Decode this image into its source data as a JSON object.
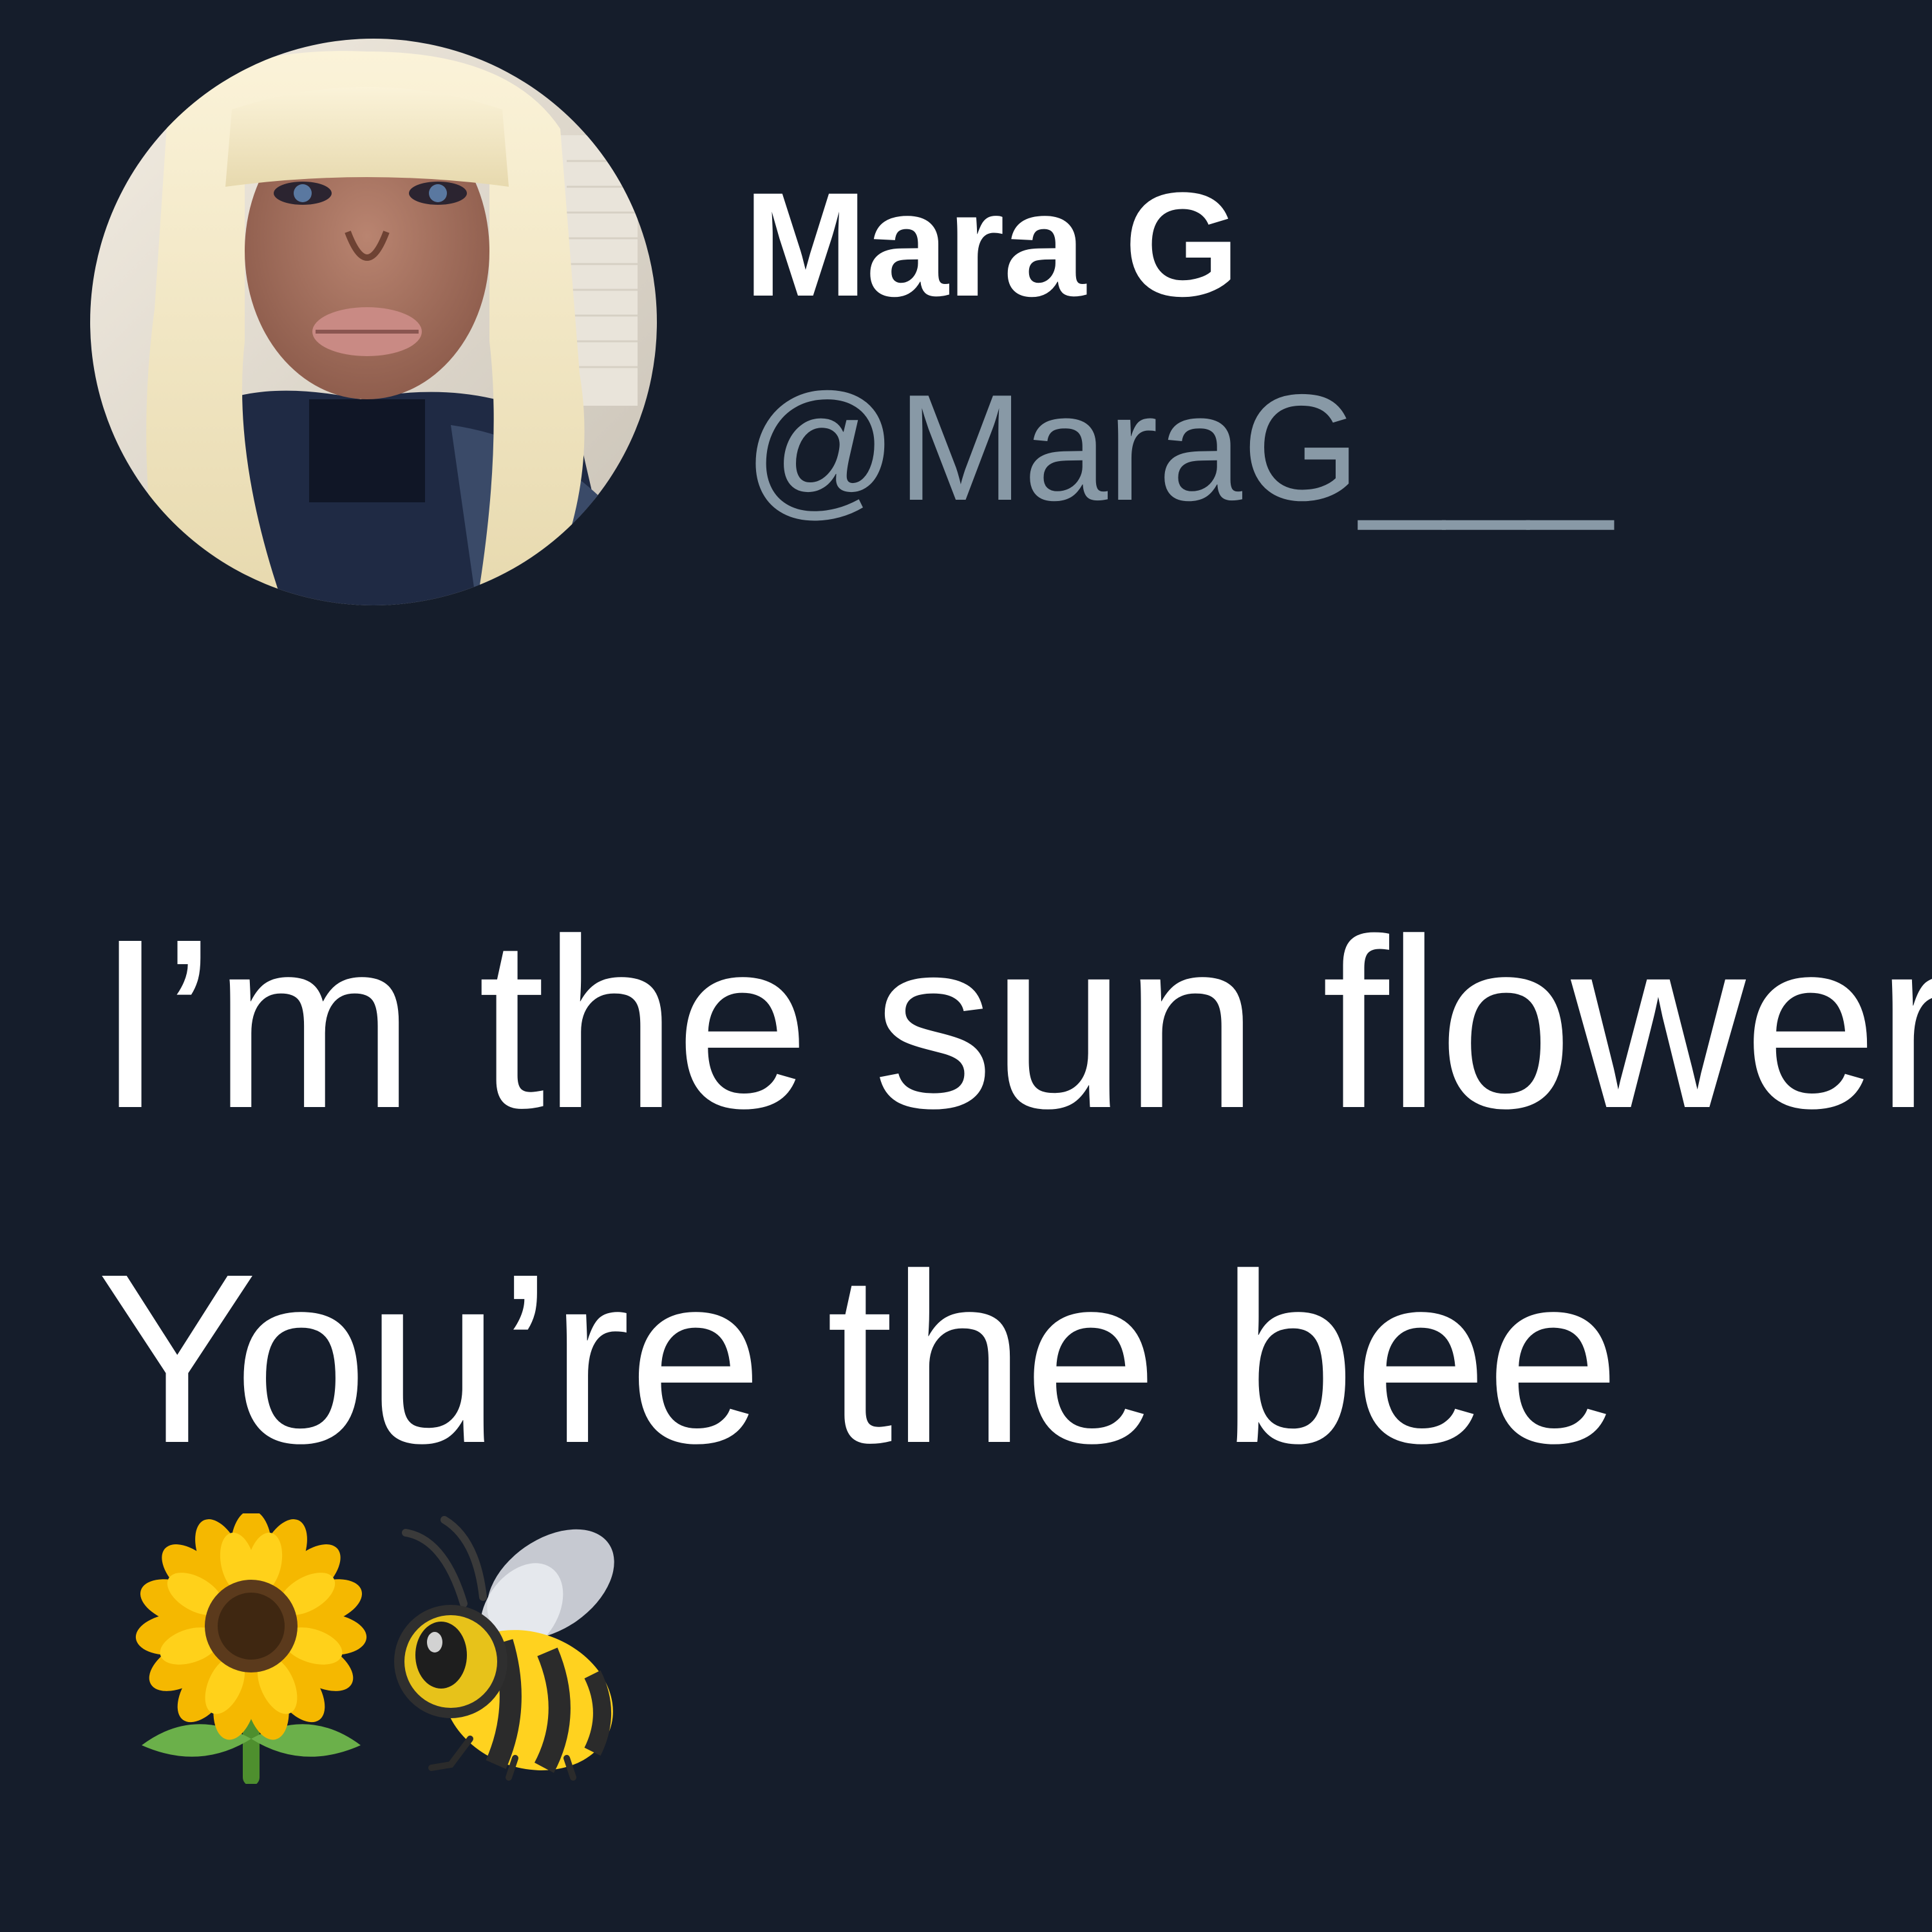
{
  "tweet": {
    "author": {
      "display_name": "Mara G",
      "handle": "@MaraG___",
      "avatar": "profile-photo"
    },
    "text_lines": [
      "I’m the sun flower",
      "You’re the bee"
    ],
    "emojis": [
      "sunflower-emoji",
      "bee-emoji"
    ]
  },
  "colors": {
    "background": "#151d2b",
    "display_name": "#ffffff",
    "handle": "#8899a6",
    "text": "#ffffff"
  }
}
